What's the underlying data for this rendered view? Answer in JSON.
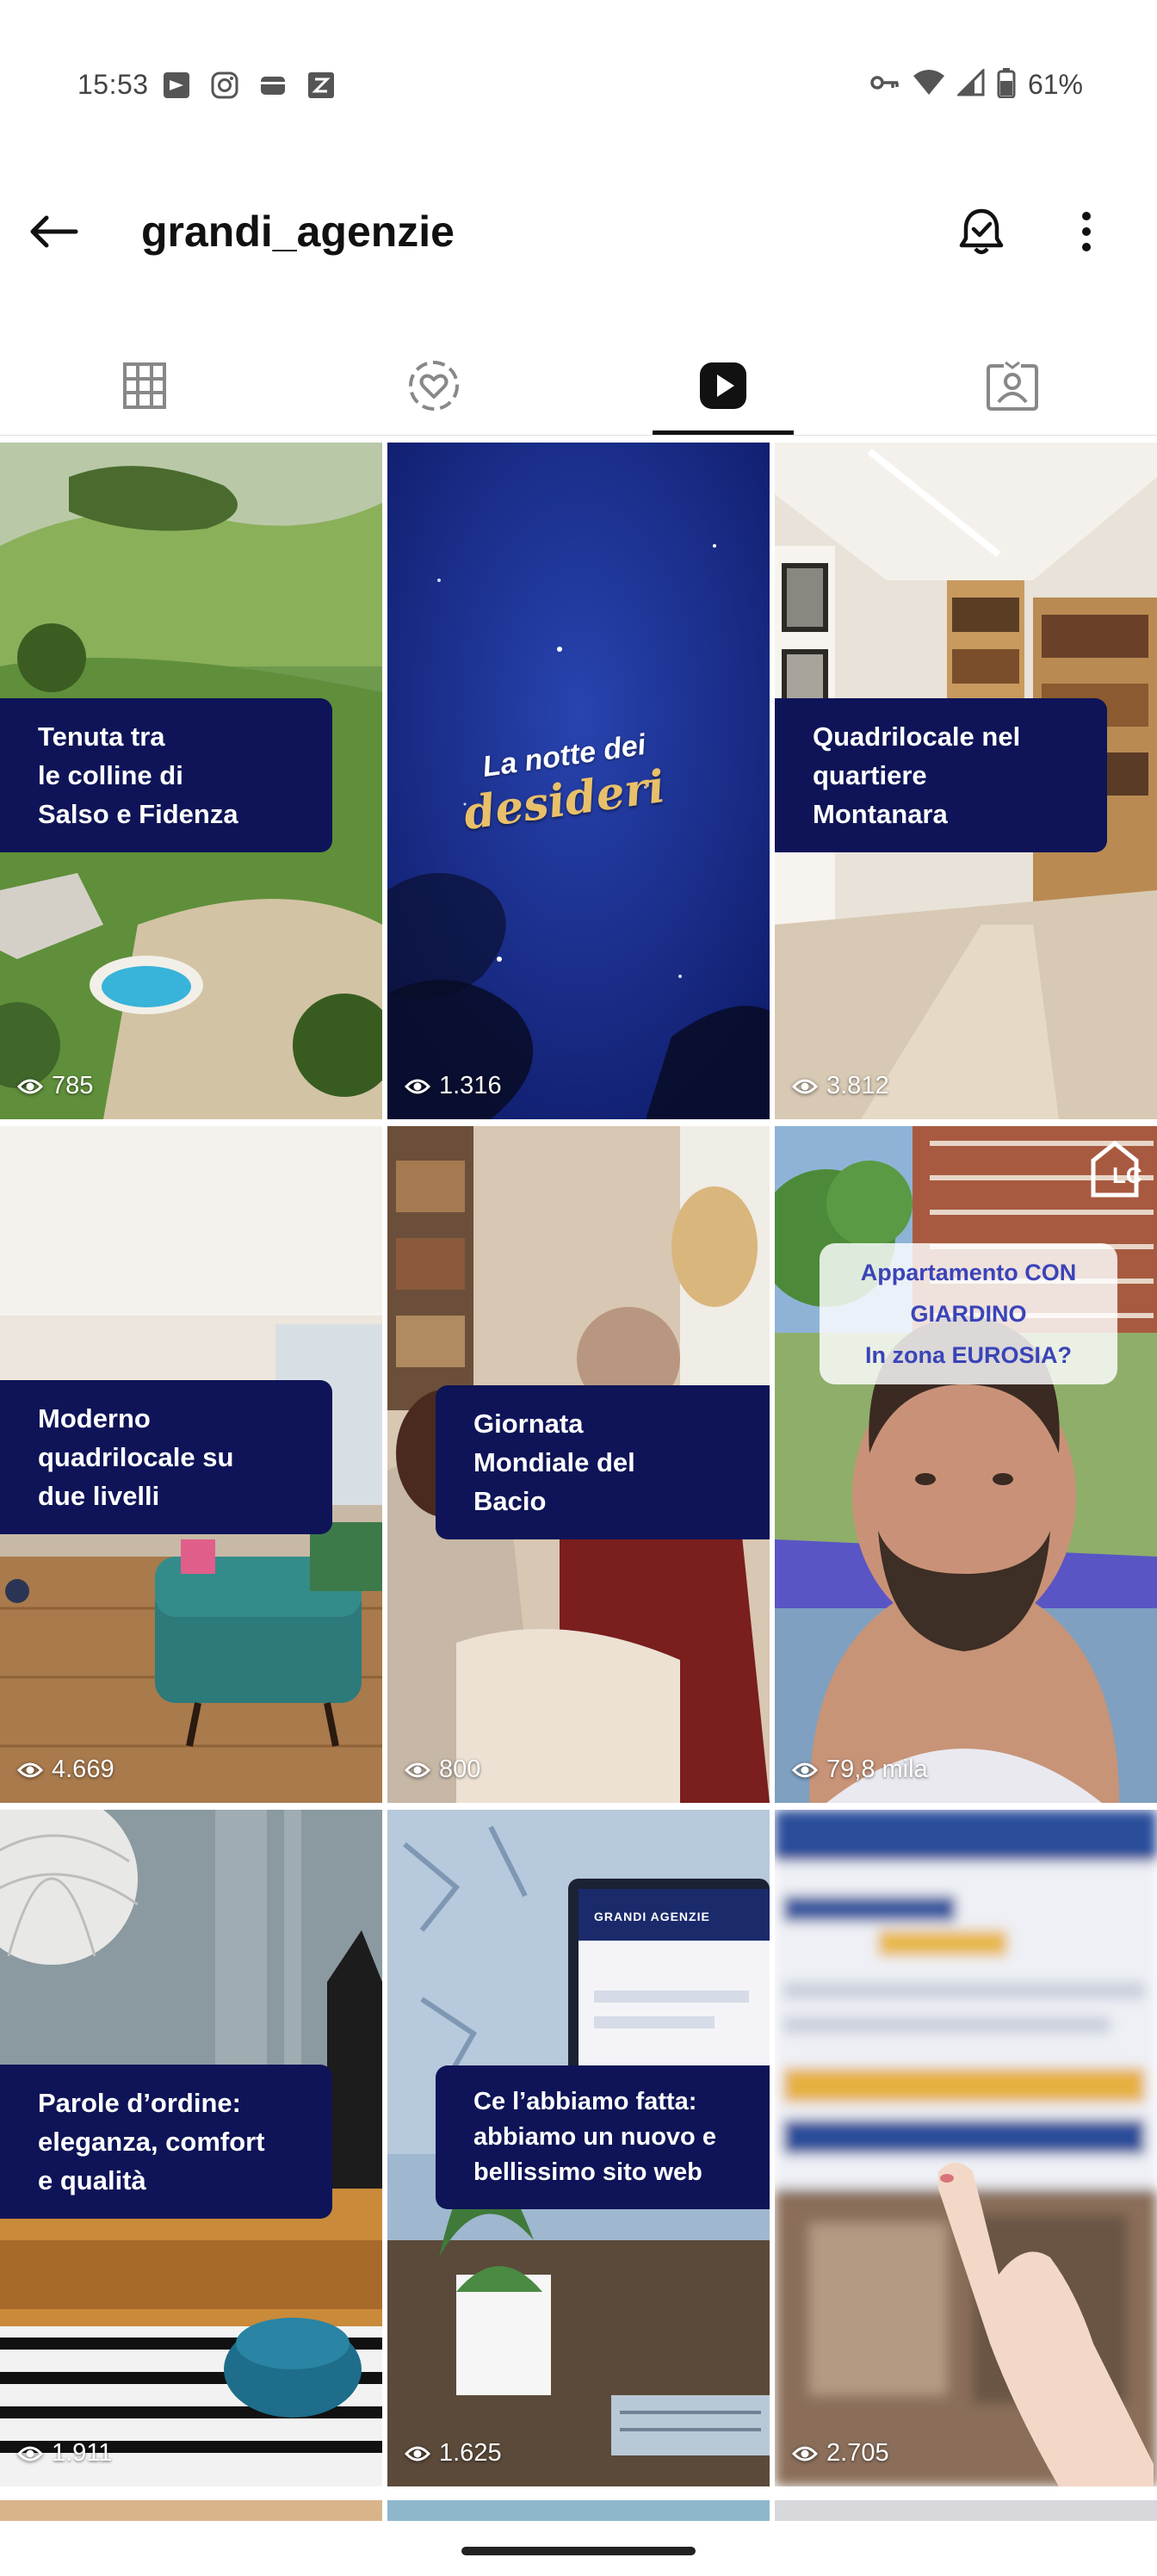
{
  "status_bar": {
    "time": "15:53",
    "app_icons": [
      "news-icon",
      "instagram-icon",
      "wallet-icon",
      "z-app-icon"
    ],
    "right_icons": [
      "key-icon",
      "wifi-icon",
      "signal-icon",
      "battery-icon"
    ],
    "battery": "61%"
  },
  "header": {
    "title": "grandi_agenzie"
  },
  "tabs": [
    {
      "name": "grid-icon",
      "active": false
    },
    {
      "name": "highlights-icon",
      "active": false
    },
    {
      "name": "reels-icon",
      "active": true
    },
    {
      "name": "tagged-icon",
      "active": false
    }
  ],
  "reels": [
    {
      "caption": "Tenuta tra\nle colline di\nSalso e Fidenza",
      "views": "785"
    },
    {
      "overlay_text_1": "La notte dei",
      "overlay_text_2": "desideri",
      "views": "1.316"
    },
    {
      "caption": "Quadrilocale nel\nquartiere\nMontanara",
      "views": "3.812"
    },
    {
      "caption": "Moderno\nquadrilocale su\ndue livelli",
      "views": "4.669"
    },
    {
      "caption": "Giornata\nMondiale del\nBacio",
      "views": "800"
    },
    {
      "bubble": "Appartamento CON\nGIARDINO\nIn zona EUROSIA?",
      "logo": "LC",
      "views": "79,8 mila"
    },
    {
      "caption": "Parole d’ordine:\neleganza, comfort\ne qualità",
      "views": "1.911"
    },
    {
      "caption": "Ce l’abbiamo fatta:\nabbiamo un nuovo e\nbellissimo sito web",
      "screen_brand": "GRANDI AGENZIE",
      "views": "1.625"
    },
    {
      "views": "2.705"
    }
  ],
  "colors": {
    "caption_bg": "#0e1457",
    "night_sky": "#1b2d8f",
    "gold": "#e8c06a"
  }
}
